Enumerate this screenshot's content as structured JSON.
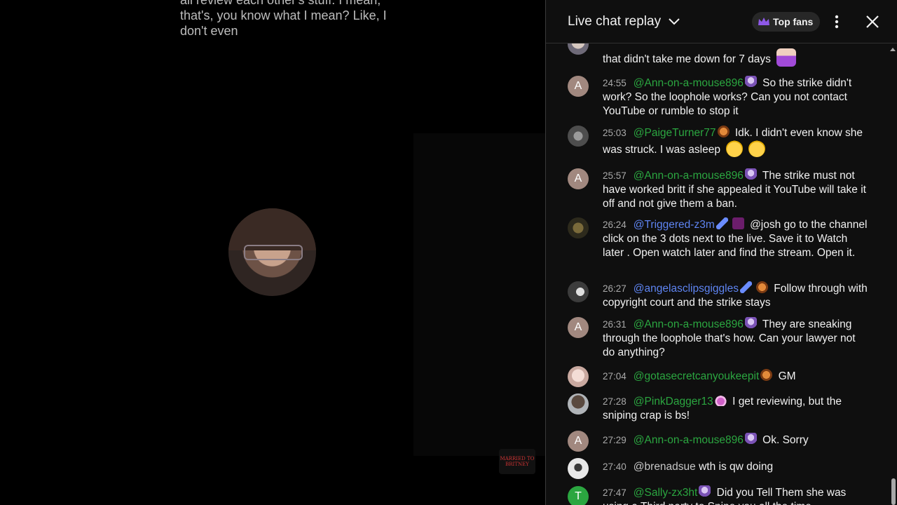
{
  "video": {
    "caption_lines": [
      "all review each other's stuff. I mean,",
      "that's, you know what I mean? Like, I",
      "don't even"
    ],
    "watermark": "MARRIED TO BRITNEY"
  },
  "chat": {
    "title": "Live chat replay",
    "top_fans_label": "Top fans",
    "messages": [
      {
        "avatar": "photo",
        "time": "",
        "author": "",
        "text": "that didn't take me down for 7 days",
        "emoji": "shrug"
      },
      {
        "avatar": "A",
        "avatar_color": "#a1887f",
        "time": "24:55",
        "author": "@Ann-on-a-mouse896",
        "badge": "umbrella",
        "text": "So the strike didn't work? So the loophole works? Can you not contact YouTube or rumble to stop it"
      },
      {
        "avatar": "photo",
        "time": "25:03",
        "author": "@PaigeTurner77",
        "badge": "pig",
        "text": "Idk. I didn't even know she was struck. I was asleep",
        "emoji": "sleep laugh"
      },
      {
        "avatar": "A",
        "avatar_color": "#a1887f",
        "time": "25:57",
        "author": "@Ann-on-a-mouse896",
        "badge": "umbrella",
        "text": "The strike must not have worked britt if she appealed it YouTube will take it off and not give them a ban."
      },
      {
        "avatar": "photo",
        "time": "26:24",
        "author": "@Triggered-z3m",
        "author_style": "moderator",
        "badge": "wrench text",
        "text": "@josh go to the channel click on the 3 dots next to the live. Save it to Watch later . Open watch later and find the stream. Open it."
      },
      {
        "avatar": "photo",
        "time": "26:27",
        "author": "@angelasclipsgiggles",
        "author_style": "moderator",
        "badge": "wrench pig",
        "text": "Follow through with copyright court and the strike stays"
      },
      {
        "avatar": "A",
        "avatar_color": "#a1887f",
        "time": "26:31",
        "author": "@Ann-on-a-mouse896",
        "badge": "umbrella",
        "text": "They are sneaking through the loophole that's how. Can your lawyer not do anything?"
      },
      {
        "avatar": "photo",
        "time": "27:04",
        "author": "@gotasecretcanyoukeepit",
        "badge": "pig",
        "text": "GM"
      },
      {
        "avatar": "photo",
        "time": "27:28",
        "author": "@PinkDagger13",
        "badge": "crown",
        "text": "I get reviewing, but the sniping crap is bs!"
      },
      {
        "avatar": "A",
        "avatar_color": "#a1887f",
        "time": "27:29",
        "author": "@Ann-on-a-mouse896",
        "badge": "umbrella",
        "text": "Ok. Sorry"
      },
      {
        "avatar": "photo",
        "time": "27:40",
        "author": "@brenadsue",
        "author_style": "regular",
        "text": "wth is qw doing"
      },
      {
        "avatar": "T",
        "avatar_color": "#2ba640",
        "time": "27:47",
        "author": "@Sally-zx3ht",
        "badge": "umbrella",
        "text": "Did you Tell Them she was using a Third party to Snipe you all the time"
      }
    ]
  },
  "colors": {
    "member_name": "#2ba640",
    "moderator_name": "#5e84f1",
    "panel_bg": "#0f0f0f",
    "timestamp": "#aaaaaa"
  }
}
